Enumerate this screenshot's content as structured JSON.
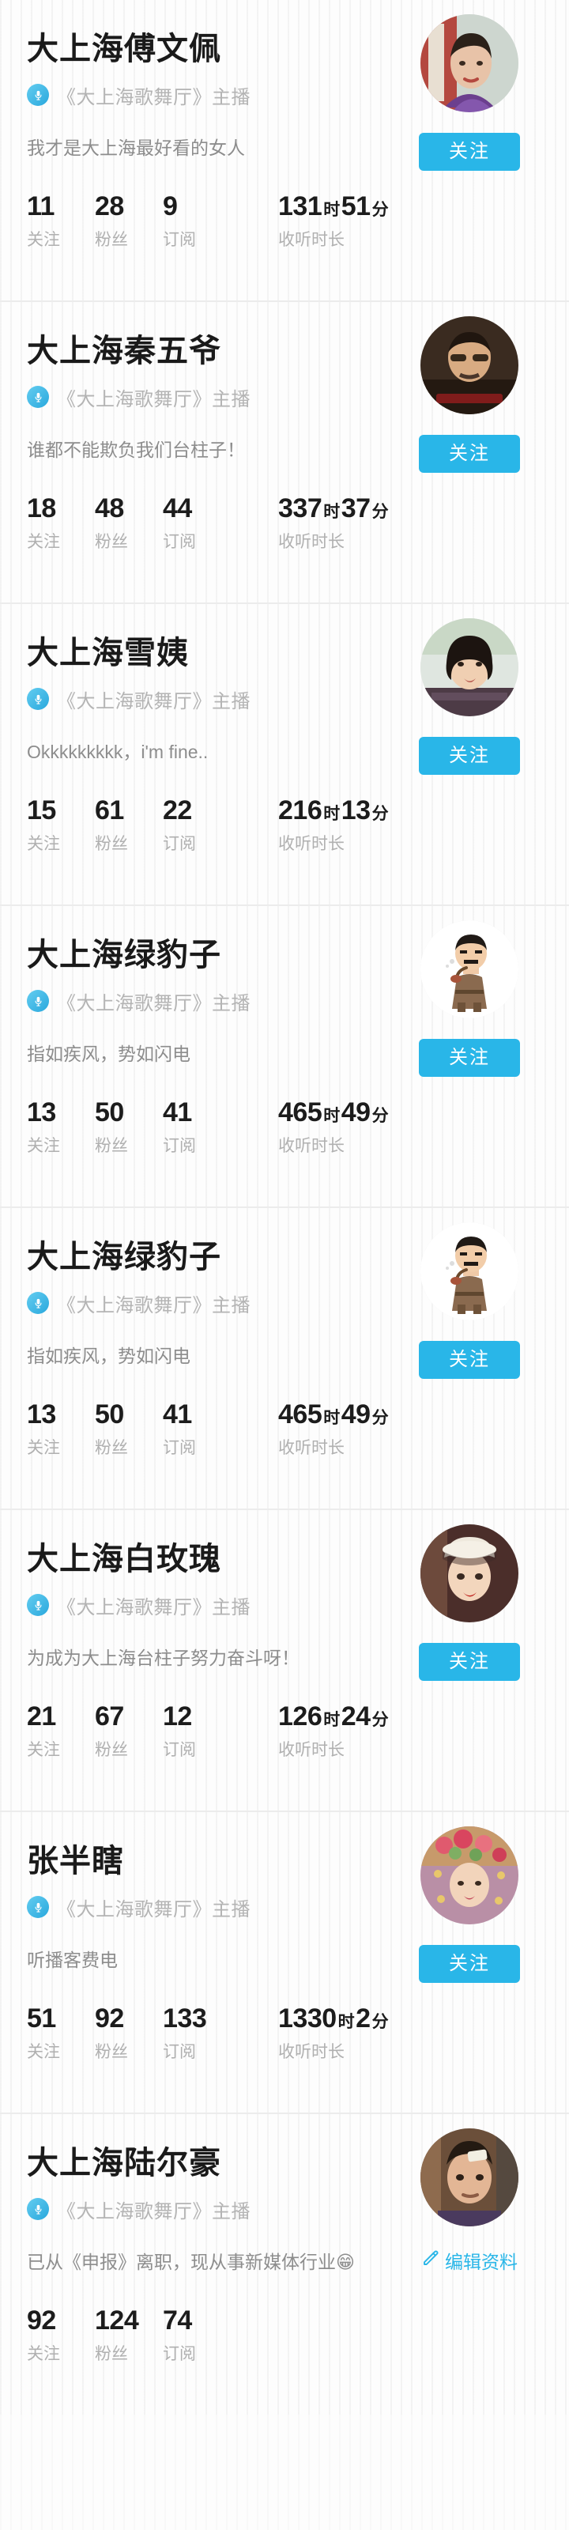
{
  "labels": {
    "following": "关注",
    "fans": "粉丝",
    "subscriptions": "订阅",
    "listen_duration": "收听时长",
    "hour_unit": "时",
    "minute_unit": "分",
    "follow_button": "关注",
    "edit_profile": "编辑资料"
  },
  "theme": {
    "accent": "#29b6e8",
    "name_color": "#1a1a1a",
    "muted": "#b0b0b0",
    "bio_color": "#8d8d8d"
  },
  "icons": {
    "microphone": "microphone-icon",
    "pencil": "pencil-icon"
  },
  "users": [
    {
      "name": "大上海傅文佩",
      "role": "《大上海歌舞厅》主播",
      "bio": "我才是大上海最好看的女人",
      "following": "11",
      "fans": "28",
      "subscriptions": "9",
      "hours": "131",
      "minutes": "51",
      "action": "follow",
      "avatar": "woman-purple-qipao"
    },
    {
      "name": "大上海秦五爷",
      "role": "《大上海歌舞厅》主播",
      "bio": "谁都不能欺负我们台柱子！",
      "following": "18",
      "fans": "48",
      "subscriptions": "44",
      "hours": "337",
      "minutes": "37",
      "action": "follow",
      "avatar": "older-man-dark"
    },
    {
      "name": "大上海雪姨",
      "role": "《大上海歌舞厅》主播",
      "bio": "Okkkkkkkkk，i'm fine..",
      "following": "15",
      "fans": "61",
      "subscriptions": "22",
      "hours": "216",
      "minutes": "13",
      "action": "follow",
      "avatar": "woman-short-hair"
    },
    {
      "name": "大上海绿豹子",
      "role": "《大上海歌舞厅》主播",
      "bio": "指如疾风，势如闪电",
      "following": "13",
      "fans": "50",
      "subscriptions": "41",
      "hours": "465",
      "minutes": "49",
      "action": "follow",
      "avatar": "cartoon-man-pipe"
    },
    {
      "name": "大上海绿豹子",
      "role": "《大上海歌舞厅》主播",
      "bio": "指如疾风，势如闪电",
      "following": "13",
      "fans": "50",
      "subscriptions": "41",
      "hours": "465",
      "minutes": "49",
      "action": "follow",
      "avatar": "cartoon-man-pipe"
    },
    {
      "name": "大上海白玫瑰",
      "role": "《大上海歌舞厅》主播",
      "bio": "为成为大上海台柱子努力奋斗呀！",
      "following": "21",
      "fans": "67",
      "subscriptions": "12",
      "hours": "126",
      "minutes": "24",
      "action": "follow",
      "avatar": "woman-white-hat"
    },
    {
      "name": "张半瞎",
      "role": "《大上海歌舞厅》主播",
      "bio": "听播客费电",
      "following": "51",
      "fans": "92",
      "subscriptions": "133",
      "hours": "1330",
      "minutes": "2",
      "action": "follow",
      "avatar": "woman-flower-crown"
    },
    {
      "name": "大上海陆尔豪",
      "role": "《大上海歌舞厅》主播",
      "bio": "已从《申报》离职，现从事新媒体行业😁",
      "following": "92",
      "fans": "124",
      "subscriptions": "74",
      "hours": "",
      "minutes": "",
      "action": "edit",
      "avatar": "man-bandage-forehead"
    }
  ]
}
